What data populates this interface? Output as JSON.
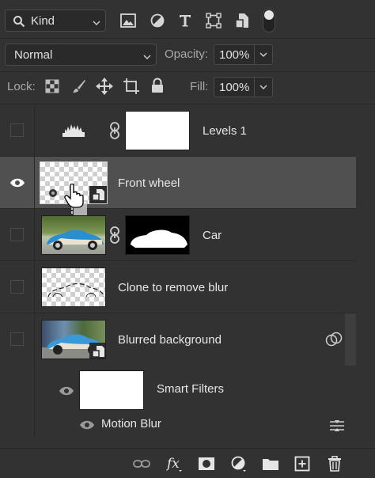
{
  "toolbar": {
    "filter_kind": "Kind",
    "filter_icons": [
      "image-filter-icon",
      "adjustment-filter-icon",
      "type-filter-icon",
      "shape-filter-icon",
      "smart-object-filter-icon",
      "filter-toggle-icon"
    ],
    "blend_mode": "Normal",
    "opacity_label": "Opacity:",
    "opacity_value": "100%",
    "lock_label": "Lock:",
    "lock_icons": [
      "lock-transparent-icon",
      "lock-paint-icon",
      "lock-position-icon",
      "lock-artboard-icon",
      "lock-all-icon"
    ],
    "fill_label": "Fill:",
    "fill_value": "100%"
  },
  "layers": [
    {
      "name": "Levels 1",
      "visible": false,
      "type": "adjustment"
    },
    {
      "name": "Front wheel",
      "visible": true,
      "selected": true,
      "type": "smart-object"
    },
    {
      "name": "Car",
      "visible": false,
      "type": "masked-image"
    },
    {
      "name": "Clone to remove blur",
      "visible": false,
      "type": "pixel"
    },
    {
      "name": "Blurred background",
      "visible": false,
      "type": "smart-object"
    },
    {
      "name": "Smart Filters",
      "visible": true,
      "type": "smart-filters"
    },
    {
      "name": "Motion Blur",
      "visible": true,
      "type": "filter"
    }
  ],
  "bottom_icons": [
    "link-layers-icon",
    "fx-icon",
    "add-mask-icon",
    "new-adjustment-icon",
    "new-group-icon",
    "new-layer-icon",
    "delete-layer-icon"
  ],
  "colors": {
    "panel": "#323232",
    "selected_row": "#505050",
    "text": "#e6e6e6"
  }
}
